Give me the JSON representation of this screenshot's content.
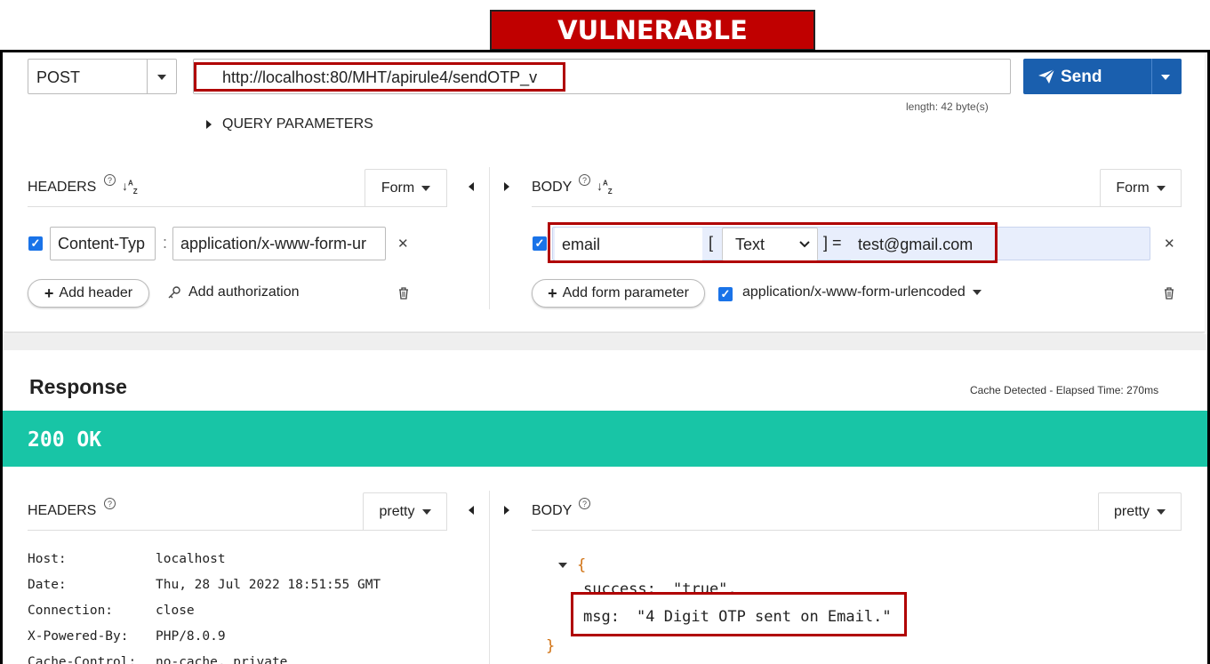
{
  "banner": {
    "label": "VULNERABLE"
  },
  "request": {
    "method": "POST",
    "url": "http://localhost:80/MHT/apirule4/sendOTP_v",
    "send_label": "Send",
    "length_info": "length: 42 byte(s)",
    "query_params_label": "QUERY PARAMETERS"
  },
  "req_headers": {
    "title": "HEADERS",
    "format": "Form",
    "rows": [
      {
        "name": "Content-Typ",
        "value": "application/x-www-form-ur"
      }
    ],
    "add_header": "Add header",
    "add_authorization": "Add authorization"
  },
  "req_body": {
    "title": "BODY",
    "format": "Form",
    "params": [
      {
        "key": "email",
        "type": "Text",
        "value": "test@gmail.com"
      }
    ],
    "bracket_open": "[",
    "bracket_close_eq": "] =",
    "add_param": "Add form parameter",
    "content_type": "application/x-www-form-urlencoded"
  },
  "response": {
    "title": "Response",
    "cache_info": "Cache Detected - Elapsed Time: 270ms",
    "status": "200 OK",
    "headers_title": "HEADERS",
    "headers_format": "pretty",
    "body_title": "BODY",
    "body_format": "pretty",
    "headers": [
      {
        "name": "Host:",
        "value": "localhost"
      },
      {
        "name": "Date:",
        "value": "Thu, 28 Jul 2022 18:51:55 GMT"
      },
      {
        "name": "Connection:",
        "value": "close"
      },
      {
        "name": "X-Powered-By:",
        "value": "PHP/8.0.9"
      },
      {
        "name": "Cache-Control:",
        "value": "no-cache, private"
      }
    ],
    "body": {
      "open": "{",
      "close": "}",
      "success_key": "success:",
      "success_val": "\"true\",",
      "msg_key": "msg:",
      "msg_val": "\"4 Digit OTP sent on Email.\""
    }
  },
  "colors": {
    "banner": "#c00000",
    "send": "#1a5fae",
    "status_ok": "#18c5a6",
    "highlight": "#b00000"
  }
}
